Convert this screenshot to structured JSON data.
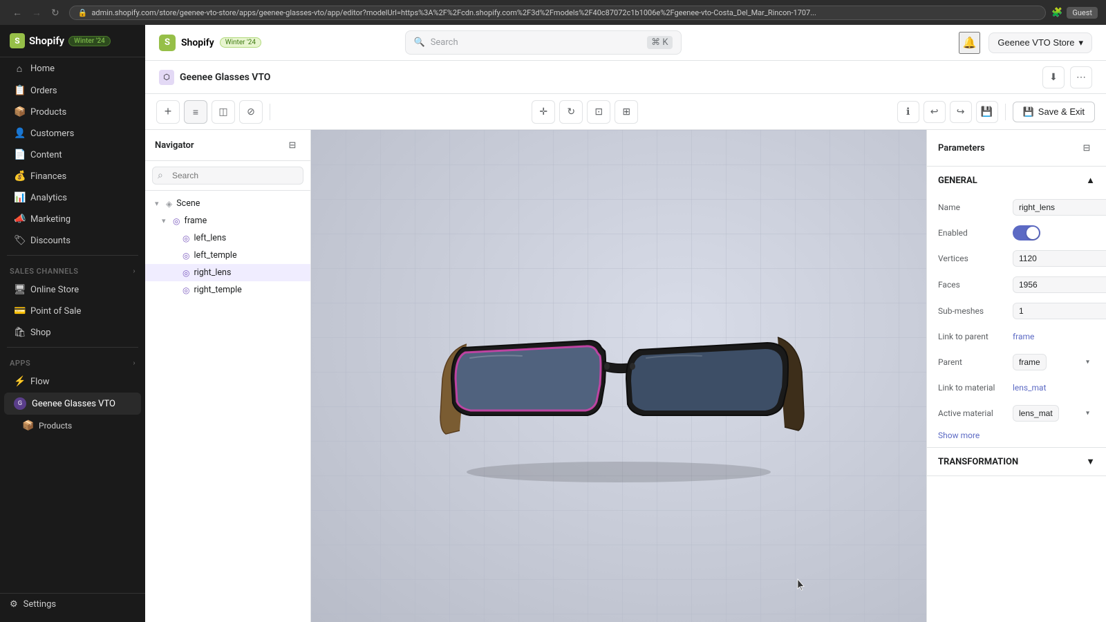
{
  "browser": {
    "back_btn": "←",
    "forward_btn": "→",
    "refresh_btn": "↻",
    "url": "admin.shopify.com/store/geenee-vto-store/apps/geenee-glasses-vto/app/editor?modelUrl=https%3A%2F%2Fcdn.shopify.com%2F3d%2Fmodels%2F40c87072c1b1006e%2Fgeenee-vto-Costa_Del_Mar_Rincon-1707...",
    "guest_label": "Guest"
  },
  "shopify_admin": {
    "logo_letter": "S",
    "app_name": "Shopify",
    "winter_badge": "Winter '24",
    "search_placeholder": "Search",
    "search_shortcut": "⌘ K",
    "notification_icon": "🔔",
    "store_name": "Geenee VTO Store"
  },
  "sidebar": {
    "items": [
      {
        "label": "Home",
        "icon": "⌂"
      },
      {
        "label": "Orders",
        "icon": "📋"
      },
      {
        "label": "Products",
        "icon": "📦"
      },
      {
        "label": "Customers",
        "icon": "👤"
      },
      {
        "label": "Content",
        "icon": "📄"
      },
      {
        "label": "Finances",
        "icon": "💰"
      },
      {
        "label": "Analytics",
        "icon": "📊"
      },
      {
        "label": "Marketing",
        "icon": "📣"
      },
      {
        "label": "Discounts",
        "icon": "🏷"
      }
    ],
    "sales_channels_label": "Sales channels",
    "sales_channels": [
      {
        "label": "Online Store",
        "icon": "🖥"
      },
      {
        "label": "Point of Sale",
        "icon": "💳"
      },
      {
        "label": "Shop",
        "icon": "🛍"
      }
    ],
    "apps_label": "Apps",
    "apps": [
      {
        "label": "Flow",
        "icon": "⚡"
      },
      {
        "label": "Geenee Glasses VTO",
        "icon": "G",
        "active": true
      },
      {
        "label": "Products",
        "icon": "📦",
        "sub": true
      }
    ],
    "settings_label": "Settings",
    "settings_icon": "⚙"
  },
  "page_header": {
    "icon": "⬡",
    "title": "Geenee Glasses VTO",
    "download_icon": "⬇",
    "more_icon": "⋯"
  },
  "editor": {
    "toolbar_left": [
      {
        "label": "+",
        "name": "add-btn",
        "icon": "+"
      },
      {
        "label": "list",
        "name": "list-btn",
        "icon": "≡"
      },
      {
        "label": "layers",
        "name": "layers-btn",
        "icon": "◫"
      },
      {
        "label": "material",
        "name": "material-btn",
        "icon": "⊘"
      }
    ],
    "toolbar_center": [
      {
        "label": "move",
        "name": "move-tool",
        "icon": "✛"
      },
      {
        "label": "rotate",
        "name": "rotate-tool",
        "icon": "↻"
      },
      {
        "label": "scale",
        "name": "scale-tool",
        "icon": "⊡"
      },
      {
        "label": "transform",
        "name": "transform-tool",
        "icon": "⊞"
      }
    ],
    "toolbar_right": [
      {
        "label": "info",
        "name": "info-btn",
        "icon": "ℹ"
      },
      {
        "label": "undo",
        "name": "undo-btn",
        "icon": "↩"
      },
      {
        "label": "redo",
        "name": "redo-btn",
        "icon": "↪"
      },
      {
        "label": "save-file",
        "name": "save-file-btn",
        "icon": "💾"
      }
    ],
    "save_exit_label": "Save & Exit"
  },
  "navigator": {
    "title": "Navigator",
    "search_placeholder": "Search",
    "filter_icon": "⊟",
    "tree": [
      {
        "label": "Scene",
        "type": "scene",
        "level": 0,
        "expanded": true,
        "icon": "▾"
      },
      {
        "label": "frame",
        "type": "group",
        "level": 1,
        "expanded": true,
        "icon": "▾",
        "node_icon": "◎"
      },
      {
        "label": "left_lens",
        "type": "mesh",
        "level": 2,
        "icon": "·",
        "node_icon": "◎"
      },
      {
        "label": "left_temple",
        "type": "mesh",
        "level": 2,
        "icon": "·",
        "node_icon": "◎"
      },
      {
        "label": "right_lens",
        "type": "mesh",
        "level": 2,
        "icon": "·",
        "node_icon": "◎",
        "selected": true
      },
      {
        "label": "right_temple",
        "type": "mesh",
        "level": 2,
        "icon": "·",
        "node_icon": "◎"
      }
    ]
  },
  "parameters": {
    "title": "Parameters",
    "filter_icon": "⊟",
    "general_section": "GENERAL",
    "fields": [
      {
        "label": "Name",
        "value": "right_lens",
        "type": "input"
      },
      {
        "label": "Enabled",
        "value": true,
        "type": "toggle"
      },
      {
        "label": "Vertices",
        "value": "1120",
        "type": "input"
      },
      {
        "label": "Faces",
        "value": "1956",
        "type": "input"
      },
      {
        "label": "Sub-meshes",
        "value": "1",
        "type": "input"
      },
      {
        "label": "Link to parent",
        "value": "frame",
        "type": "link"
      },
      {
        "label": "Parent",
        "value": "frame",
        "type": "select"
      },
      {
        "label": "Link to material",
        "value": "lens_mat",
        "type": "link"
      },
      {
        "label": "Active material",
        "value": "lens_mat",
        "type": "select"
      }
    ],
    "show_more": "Show more",
    "transformation_section": "TRANSFORMATION"
  }
}
